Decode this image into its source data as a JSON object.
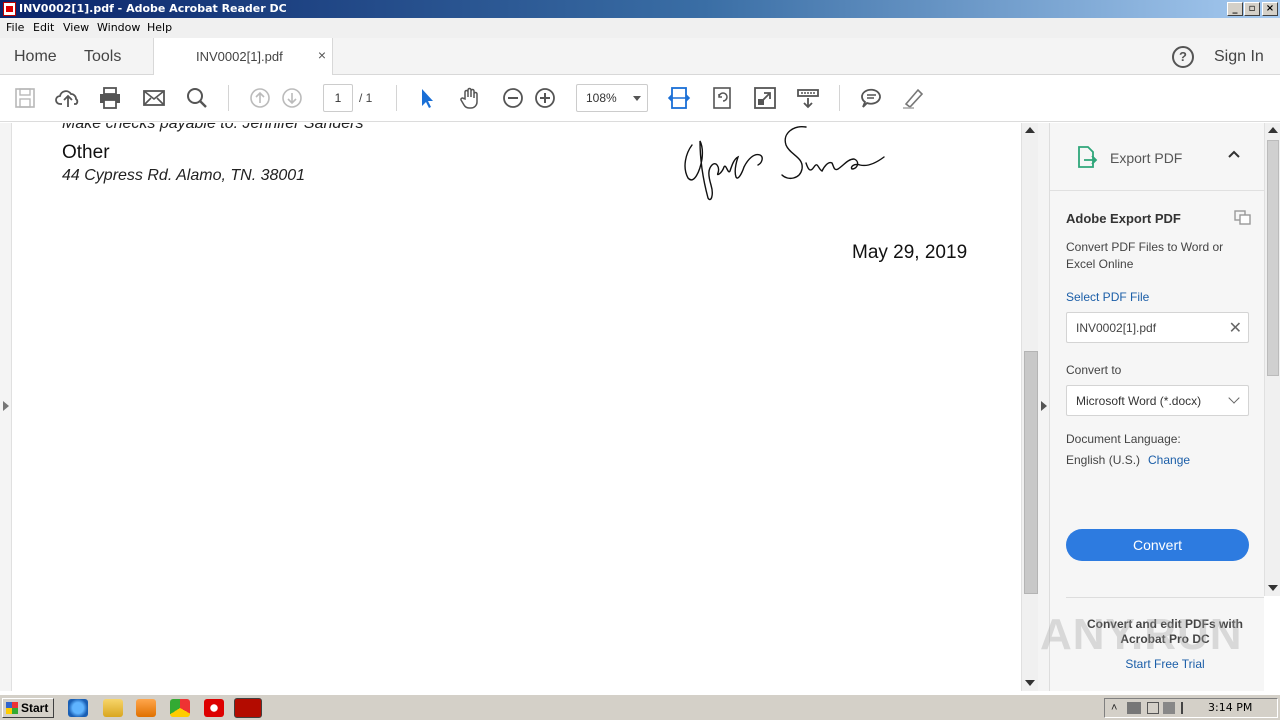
{
  "window": {
    "title": "INV0002[1].pdf - Adobe Acrobat Reader DC"
  },
  "menu": [
    "File",
    "Edit",
    "View",
    "Window",
    "Help"
  ],
  "tabs": {
    "home": "Home",
    "tools": "Tools",
    "document": "INV0002[1].pdf",
    "close_glyph": "×"
  },
  "header": {
    "help_glyph": "?",
    "sign_in": "Sign In"
  },
  "toolbar": {
    "page_current": "1",
    "page_total": "/ 1",
    "zoom": "108%"
  },
  "document": {
    "line_checks": "Make checks payable to: Jennifer Sanders",
    "other_heading": "Other",
    "address": "44 Cypress Rd. Alamo, TN. 38001",
    "date": "May 29, 2019"
  },
  "export_pane": {
    "title": "Export PDF",
    "heading": "Adobe Export PDF",
    "description": "Convert PDF Files to Word or Excel Online",
    "select_label": "Select PDF File",
    "file_name": "INV0002[1].pdf",
    "file_clear_glyph": "✕",
    "convert_to_label": "Convert to",
    "format": "Microsoft Word (*.docx)",
    "language_label": "Document Language:",
    "language": "English (U.S.)",
    "change_link": "Change",
    "convert_button": "Convert",
    "promo": "Convert and edit PDFs with Acrobat Pro DC",
    "trial_link": "Start Free Trial"
  },
  "watermark": "ANY.RUN",
  "taskbar": {
    "start": "Start",
    "clock": "3:14 PM"
  },
  "colors": {
    "accent": "#2d7be0",
    "link": "#1b5ea8",
    "titlebar": "#0a246a"
  },
  "icons": [
    "save-icon",
    "cloud-upload-icon",
    "print-icon",
    "email-icon",
    "search-icon",
    "prev-page-icon",
    "next-page-icon",
    "select-arrow-icon",
    "hand-icon",
    "zoom-out-icon",
    "zoom-in-icon",
    "fit-width-icon",
    "rotate-icon",
    "full-screen-icon",
    "read-mode-icon",
    "comment-icon",
    "highlight-icon"
  ]
}
